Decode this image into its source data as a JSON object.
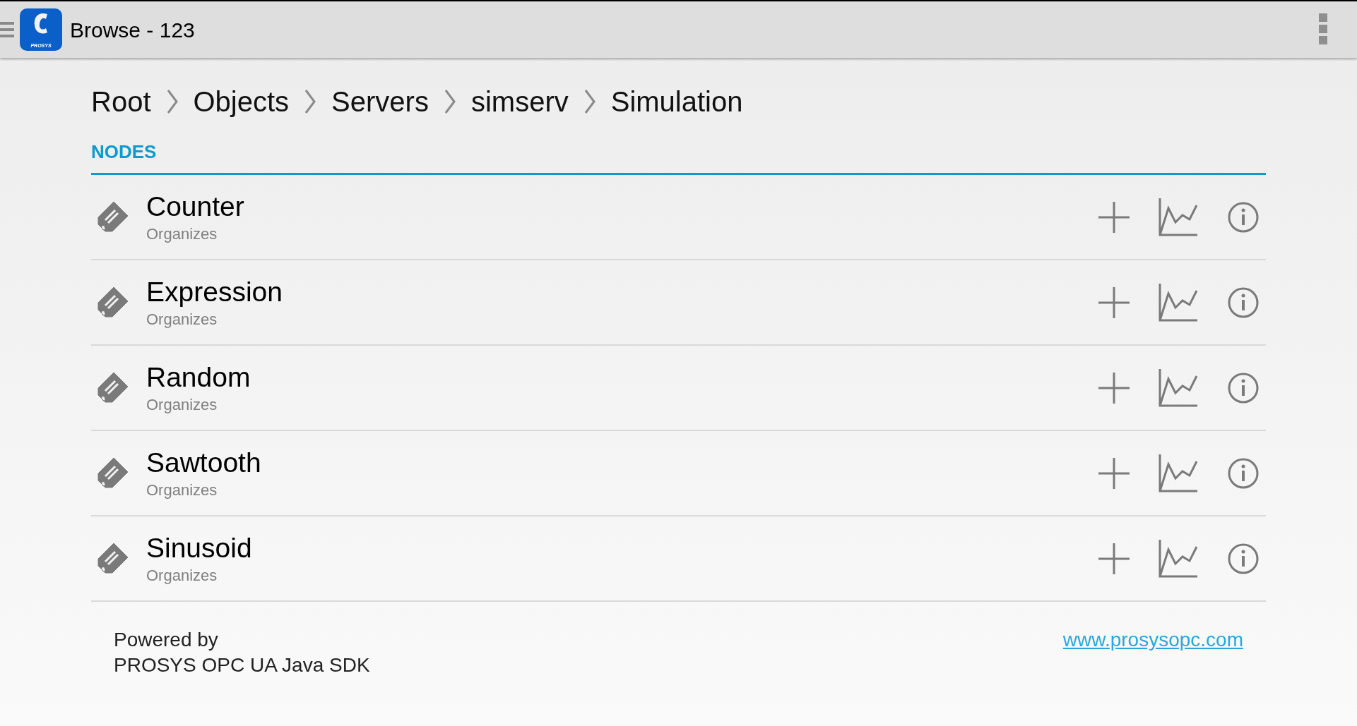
{
  "app_bar": {
    "logo_text": "PROSYS",
    "title": "Browse - 123"
  },
  "breadcrumb": [
    "Root",
    "Objects",
    "Servers",
    "simserv",
    "Simulation"
  ],
  "section": {
    "title": "NODES"
  },
  "nodes": [
    {
      "name": "Counter",
      "reference": "Organizes"
    },
    {
      "name": "Expression",
      "reference": "Organizes"
    },
    {
      "name": "Random",
      "reference": "Organizes"
    },
    {
      "name": "Sawtooth",
      "reference": "Organizes"
    },
    {
      "name": "Sinusoid",
      "reference": "Organizes"
    }
  ],
  "footer": {
    "powered_by": [
      "Powered by",
      "PROSYS OPC UA Java SDK"
    ],
    "link": "www.prosysopc.com"
  }
}
